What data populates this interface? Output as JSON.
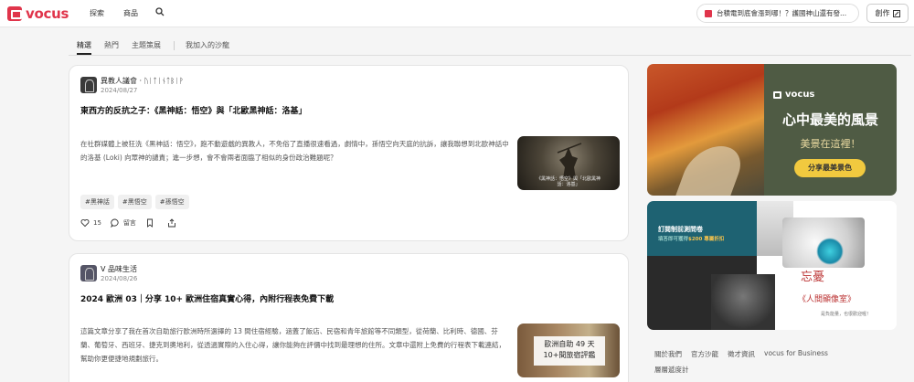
{
  "header": {
    "logo_text": "vocus",
    "nav": [
      "探索",
      "商品"
    ],
    "promo_text": "台積電到底會漲到哪！？護國神山還有發...",
    "write_label": "創作"
  },
  "tabs": [
    "精選",
    "熱門",
    "主題策展",
    "我加入的沙龍"
  ],
  "posts": [
    {
      "author": "異教人議會 · ᚢᛁᛏᛁᚾᛏᛒᛁᚹ",
      "date": "2024/08/27",
      "title": "東西方的反抗之子：《黑神話：悟空》與「北歐黑神話：洛基」",
      "excerpt": "在社群媒體上被狂洗《黑神話：悟空》，跑不動遊戲的異教人，不免俗了直播很速看過，劇情中，孫悟空向天庭的抗訴，讓我聯想到北歐神話中的洛基 (Loki) 向眾神的譴責；進一步想，會不會兩者面臨了相似的身份政治難題呢？",
      "tags": [
        "#黑神話",
        "#黑悟空",
        "#孫悟空"
      ],
      "likes": "15",
      "comment_label": "留言",
      "thumb_caption": "《黑神話：悟空》與「北歐黑神話：洛基」"
    },
    {
      "author": "V 品味生活",
      "date": "2024/08/26",
      "title": "2024 歐洲 03｜分享 10+ 歐洲住宿真實心得，內附行程表免費下載",
      "excerpt": "這篇文章分享了我在首次自助旅行歐洲時所選擇的 13 間住宿經驗，涵蓋了飯店、民宿和青年旅館等不同類型，從荷蘭、比利時、德國、芬蘭、葡萄牙、西班牙、捷克到奧地利，從透過實際的入住心得，讓你能夠在評價中找到最理想的住所。文章中還附上免費的行程表下載連結，幫助你更便捷地規劃旅行。",
      "thumb_caption": "歐洲自助 49 天 10+間旅宿評鑑"
    }
  ],
  "sidebar": {
    "ad1": {
      "brand": "vocus",
      "title": "心中最美的風景",
      "subtitle": "美景在這裡！",
      "button": "分享最美景色"
    },
    "ad2": {
      "heading": "訂閱制前測問卷",
      "subtext_prefix": "填答即可獲得",
      "subtext_highlight": "$200 專屬折扣",
      "calligraphy": "忘憂",
      "title": "《人間顯像室》",
      "tagline": "是負能量，也很歡迎喔！"
    },
    "footer_links": [
      "關於我們",
      "官方沙龍",
      "徵才資訊",
      "vocus for Business",
      "層層遞度計"
    ]
  },
  "colors": {
    "brand": "#e0354b",
    "ad_green": "#4f5b44",
    "ad_yellow": "#f1c93f"
  }
}
